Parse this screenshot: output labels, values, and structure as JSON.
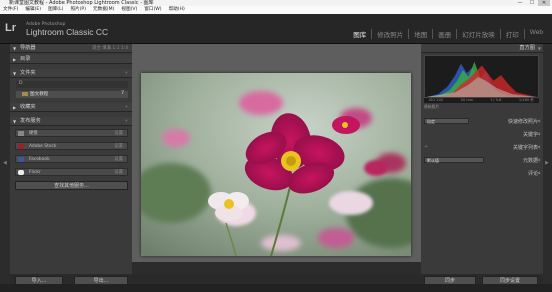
{
  "window": {
    "title": "新课堂图文教程 - Adobe Photoshop Lightroom Classic - 图库",
    "controls": [
      "—",
      "☐",
      "✕"
    ]
  },
  "menu": [
    "文件(F)",
    "编辑(E)",
    "图库(L)",
    "照片(P)",
    "元数据(M)",
    "视图(V)",
    "窗口(W)",
    "帮助(H)"
  ],
  "identity": {
    "logo": "Lr",
    "line1": "Adobe Photoshop",
    "line2": "Lightroom Classic CC"
  },
  "modules": [
    "图库",
    "修改照片",
    "地图",
    "画册",
    "幻灯片放映",
    "打印",
    "Web"
  ],
  "left": {
    "navigator": {
      "title": "导航器",
      "options": "适合  填满  1:1  1:4"
    },
    "catalog": "目录",
    "folders": {
      "title": "文件夹",
      "volume": "D",
      "subfolder": "图文教程",
      "subcount": "7"
    },
    "collections": "收藏夹",
    "publish": {
      "title": "发布服务",
      "items": [
        {
          "label": "硬盘",
          "count": "设置"
        },
        {
          "label": "Adobe Stock",
          "count": "设置"
        },
        {
          "label": "Facebook",
          "count": "设置"
        },
        {
          "label": "Flickr",
          "count": "设置"
        }
      ],
      "more": "查找其他服务..."
    }
  },
  "right": {
    "histogram": "直方图",
    "exif": [
      "ISO 100",
      "50 mm",
      "f / 5.6",
      "1/160 秒"
    ],
    "original": "原始照片",
    "quick_develop": "自定",
    "quick_develop_title": "快速修改照片",
    "keywording": "关键字",
    "keyword_list": "关键字列表",
    "metadata_preset": "默认值",
    "metadata": "元数据",
    "comments": "评论"
  },
  "bottom": {
    "import": "导入...",
    "export": "导出...",
    "sync": "同步",
    "sync_settings": "同步设置"
  }
}
